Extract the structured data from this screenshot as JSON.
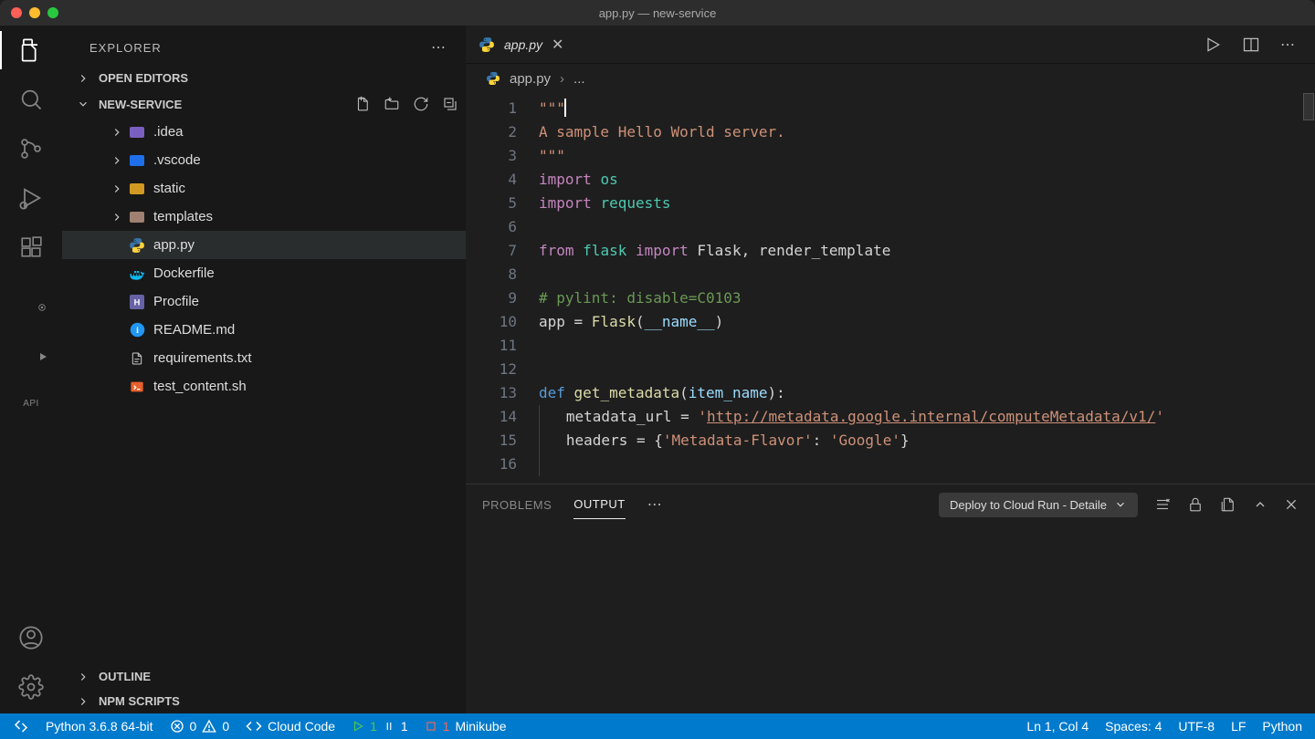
{
  "window": {
    "title": "app.py — new-service"
  },
  "sidebar": {
    "title": "EXPLORER",
    "openEditors": "OPEN EDITORS",
    "project": "NEW-SERVICE",
    "outline": "OUTLINE",
    "npmScripts": "NPM SCRIPTS",
    "tree": [
      {
        "name": ".idea",
        "type": "folder",
        "color": "#7a5fc1"
      },
      {
        "name": ".vscode",
        "type": "folder",
        "color": "#1f6feb"
      },
      {
        "name": "static",
        "type": "folder",
        "color": "#d29922"
      },
      {
        "name": "templates",
        "type": "folder",
        "color": "#a08070"
      },
      {
        "name": "app.py",
        "type": "file",
        "icon": "python",
        "selected": true
      },
      {
        "name": "Dockerfile",
        "type": "file",
        "icon": "docker"
      },
      {
        "name": "Procfile",
        "type": "file",
        "icon": "heroku"
      },
      {
        "name": "README.md",
        "type": "file",
        "icon": "info"
      },
      {
        "name": "requirements.txt",
        "type": "file",
        "icon": "text"
      },
      {
        "name": "test_content.sh",
        "type": "file",
        "icon": "shell"
      }
    ]
  },
  "tab": {
    "name": "app.py"
  },
  "breadcrumb": {
    "file": "app.py",
    "more": "..."
  },
  "code": {
    "lines": [
      {
        "n": 1,
        "html": "<span class='tok-doc'>\"\"\"</span><span class='cursor'></span>"
      },
      {
        "n": 2,
        "html": "<span class='tok-doc'>A sample Hello World server.</span>"
      },
      {
        "n": 3,
        "html": "<span class='tok-doc'>\"\"\"</span>"
      },
      {
        "n": 4,
        "html": "<span class='tok-kw2'>import</span> <span class='tok-mod'>os</span>"
      },
      {
        "n": 5,
        "html": "<span class='tok-kw2'>import</span> <span class='tok-mod'>requests</span>"
      },
      {
        "n": 6,
        "html": ""
      },
      {
        "n": 7,
        "html": "<span class='tok-kw2'>from</span> <span class='tok-mod'>flask</span> <span class='tok-kw2'>import</span> Flask, render_template"
      },
      {
        "n": 8,
        "html": ""
      },
      {
        "n": 9,
        "html": "<span class='tok-com'># pylint: disable=C0103</span>"
      },
      {
        "n": 10,
        "html": "app = <span class='tok-fn'>Flask</span>(<span class='tok-param'>__name__</span>)"
      },
      {
        "n": 11,
        "html": ""
      },
      {
        "n": 12,
        "html": ""
      },
      {
        "n": 13,
        "html": "<span class='tok-kw'>def</span> <span class='tok-fn'>get_metadata</span>(<span class='tok-param'>item_name</span>):"
      },
      {
        "n": 14,
        "html": "<span class='indent-guide'></span>   metadata_url = <span class='tok-str'>'</span><span class='tok-link'>http://metadata.google.internal/computeMetadata/v1/</span><span class='tok-str'>'</span>"
      },
      {
        "n": 15,
        "html": "<span class='indent-guide'></span>   headers = {<span class='tok-str'>'Metadata-Flavor'</span>: <span class='tok-str'>'Google'</span>}"
      },
      {
        "n": 16,
        "html": "<span class='indent-guide'></span>"
      }
    ]
  },
  "panel": {
    "tabs": {
      "problems": "PROBLEMS",
      "output": "OUTPUT"
    },
    "selector": "Deploy to Cloud Run - Detaile"
  },
  "status": {
    "python": "Python 3.6.8 64-bit",
    "errors": "0",
    "warnings": "0",
    "cloudcode": "Cloud Code",
    "running": "1",
    "paused": "1",
    "minikubeCount": "1",
    "minikube": "Minikube",
    "position": "Ln 1, Col 4",
    "spaces": "Spaces: 4",
    "encoding": "UTF-8",
    "eol": "LF",
    "language": "Python"
  }
}
